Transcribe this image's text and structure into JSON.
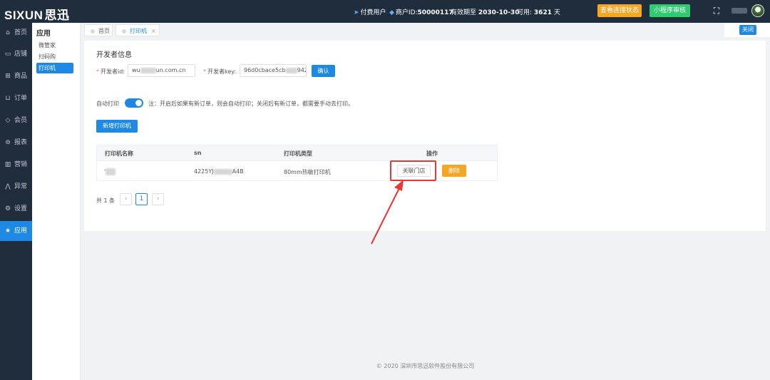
{
  "header": {
    "logo_text": "SIXUN",
    "logo_cn": "思迅",
    "user_type": "付费用户",
    "merchant_label": "商户ID:",
    "merchant_id": "50000117",
    "expire_label": "有效期至",
    "expire_date": "2030-10-30",
    "available_label": "可用:",
    "available_value": "3621",
    "available_unit": "天",
    "check_status_button": "查看连接状态",
    "miniapp_review_button": "小程序审核"
  },
  "nav": {
    "items": [
      {
        "label": "首页",
        "icon": "home-icon"
      },
      {
        "label": "店铺",
        "icon": "shop-icon"
      },
      {
        "label": "商品",
        "icon": "gift-icon"
      },
      {
        "label": "订单",
        "icon": "order-icon"
      },
      {
        "label": "会员",
        "icon": "member-icon"
      },
      {
        "label": "报表",
        "icon": "report-icon"
      },
      {
        "label": "营销",
        "icon": "chart-icon"
      },
      {
        "label": "异常",
        "icon": "warning-icon"
      },
      {
        "label": "设置",
        "icon": "gear-icon"
      },
      {
        "label": "应用",
        "icon": "star-icon"
      }
    ],
    "active": "应用"
  },
  "subnav": {
    "title": "应用",
    "items": [
      "微管家",
      "扫码购",
      "打印机"
    ],
    "active": "打印机"
  },
  "tabs": {
    "items": [
      "首页",
      "打印机"
    ],
    "active": "打印机",
    "close_all": "关闭"
  },
  "developer": {
    "section_title": "开发者信息",
    "id_label": "开发者id:",
    "id_value_start": "wu",
    "id_value_end": "un.com.cn",
    "key_label": "开发者key:",
    "key_value_start": "96d0cbace5cb",
    "key_value_end": "942",
    "confirm_button": "确认"
  },
  "auto_print": {
    "label": "自动打印",
    "enabled": true,
    "note": "注：开启后如果有新订单，则会自动打印；关闭后有新订单，都需要手动去打印。"
  },
  "add_printer_button": "新增打印机",
  "table": {
    "headers": [
      "打印机名称",
      "sn",
      "打印机类型",
      "操作"
    ],
    "rows": [
      {
        "name": "'",
        "sn_start": "4225YJ",
        "sn_end": "A4B",
        "type": "80mm热敏打印机",
        "link_store": "关联门店",
        "delete": "删除"
      }
    ]
  },
  "pagination": {
    "total_text": "共 1 条",
    "prev": "‹",
    "current": "1",
    "next": "›"
  },
  "footer": "© 2020 深圳市思迅软件股份有限公司",
  "colors": {
    "sidebar": "#1f2d3d",
    "accent": "#1e88e5",
    "orange": "#f5a623",
    "green": "#2ecc71",
    "highlight_red": "#e53935"
  }
}
